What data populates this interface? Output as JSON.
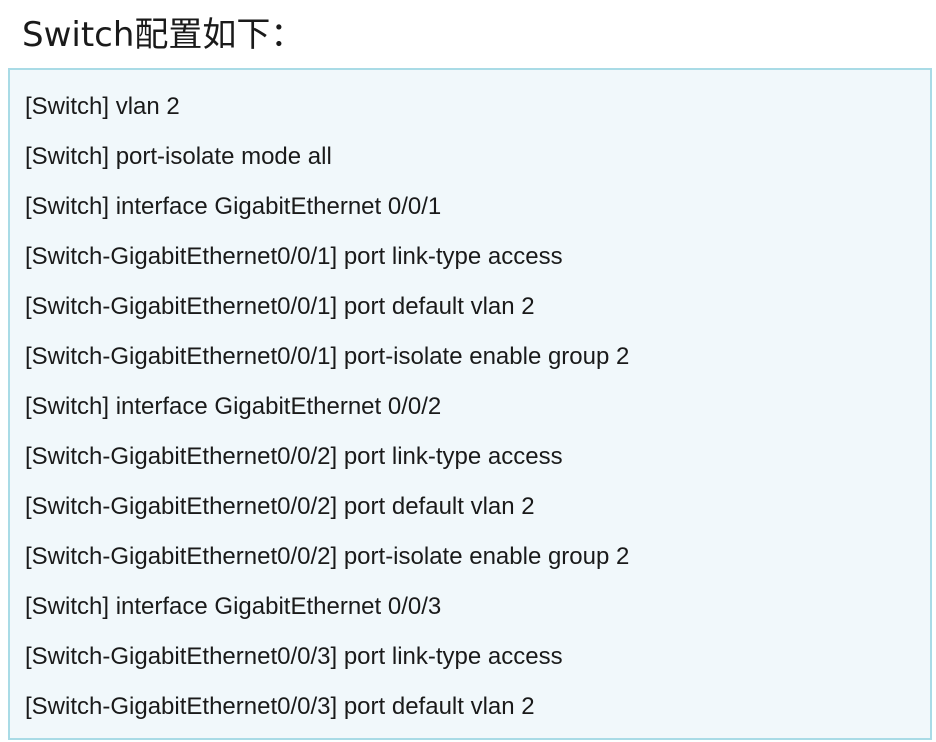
{
  "heading": "Switch配置如下：",
  "code_lines": [
    "[Switch] vlan 2",
    "[Switch] port-isolate mode all",
    "[Switch] interface GigabitEthernet 0/0/1",
    "[Switch-GigabitEthernet0/0/1] port link-type access",
    "[Switch-GigabitEthernet0/0/1] port default vlan 2",
    "[Switch-GigabitEthernet0/0/1] port-isolate enable group 2",
    "[Switch] interface GigabitEthernet 0/0/2",
    "[Switch-GigabitEthernet0/0/2] port link-type access",
    "[Switch-GigabitEthernet0/0/2] port default vlan 2",
    "[Switch-GigabitEthernet0/0/2] port-isolate enable group 2",
    "[Switch] interface GigabitEthernet 0/0/3",
    "[Switch-GigabitEthernet0/0/3] port link-type access",
    "[Switch-GigabitEthernet0/0/3] port default vlan 2"
  ],
  "colors": {
    "box_background": "#f1f8fb",
    "box_border": "#a9dbe6",
    "text": "#1a1a1a"
  }
}
